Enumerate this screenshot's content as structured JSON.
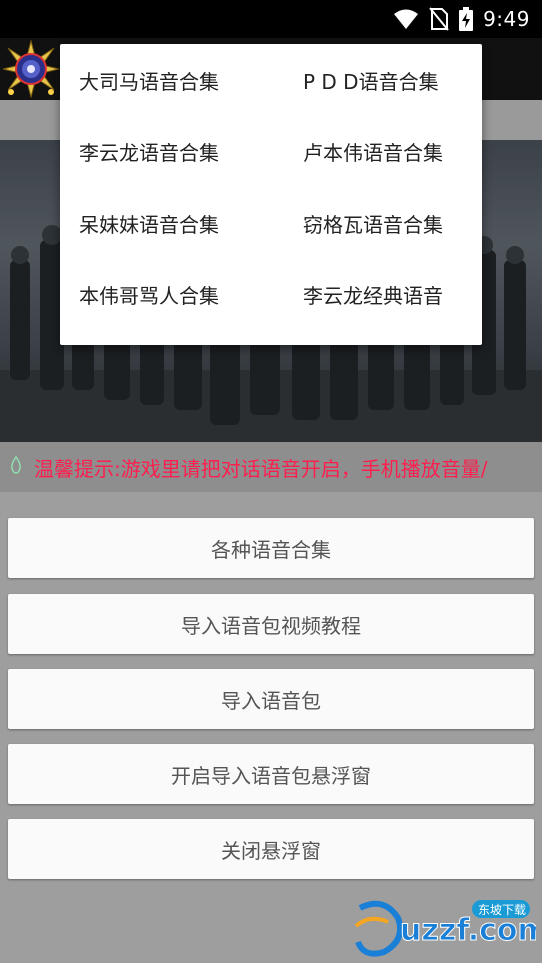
{
  "status_bar": {
    "time": "9:49",
    "icons": [
      "wifi-icon",
      "no-sim-icon",
      "battery-charging-icon"
    ]
  },
  "app_bar": {
    "logo": "app-logo-icon"
  },
  "menu": {
    "items": [
      "大司马语音合集",
      "P D D语音合集",
      "李云龙语音合集",
      "卢本伟语音合集",
      "呆妹妹语音合集",
      "窃格瓦语音合集",
      "本伟哥骂人合集",
      "李云龙经典语音"
    ]
  },
  "notice": {
    "icon": "drop-icon",
    "text": "温馨提示:游戏里请把对话语音开启，手机播放音量/"
  },
  "buttons": [
    "各种语音合集",
    "导入语音包视频教程",
    "导入语音包",
    "开启导入语音包悬浮窗",
    "关闭悬浮窗"
  ],
  "watermark": {
    "text": "uzzf.com",
    "tag": "东坡下载"
  },
  "colors": {
    "notice_text": "#ff1f4f",
    "background": "#9e9e9e",
    "button_bg": "#fafafa",
    "button_text": "#555555"
  }
}
